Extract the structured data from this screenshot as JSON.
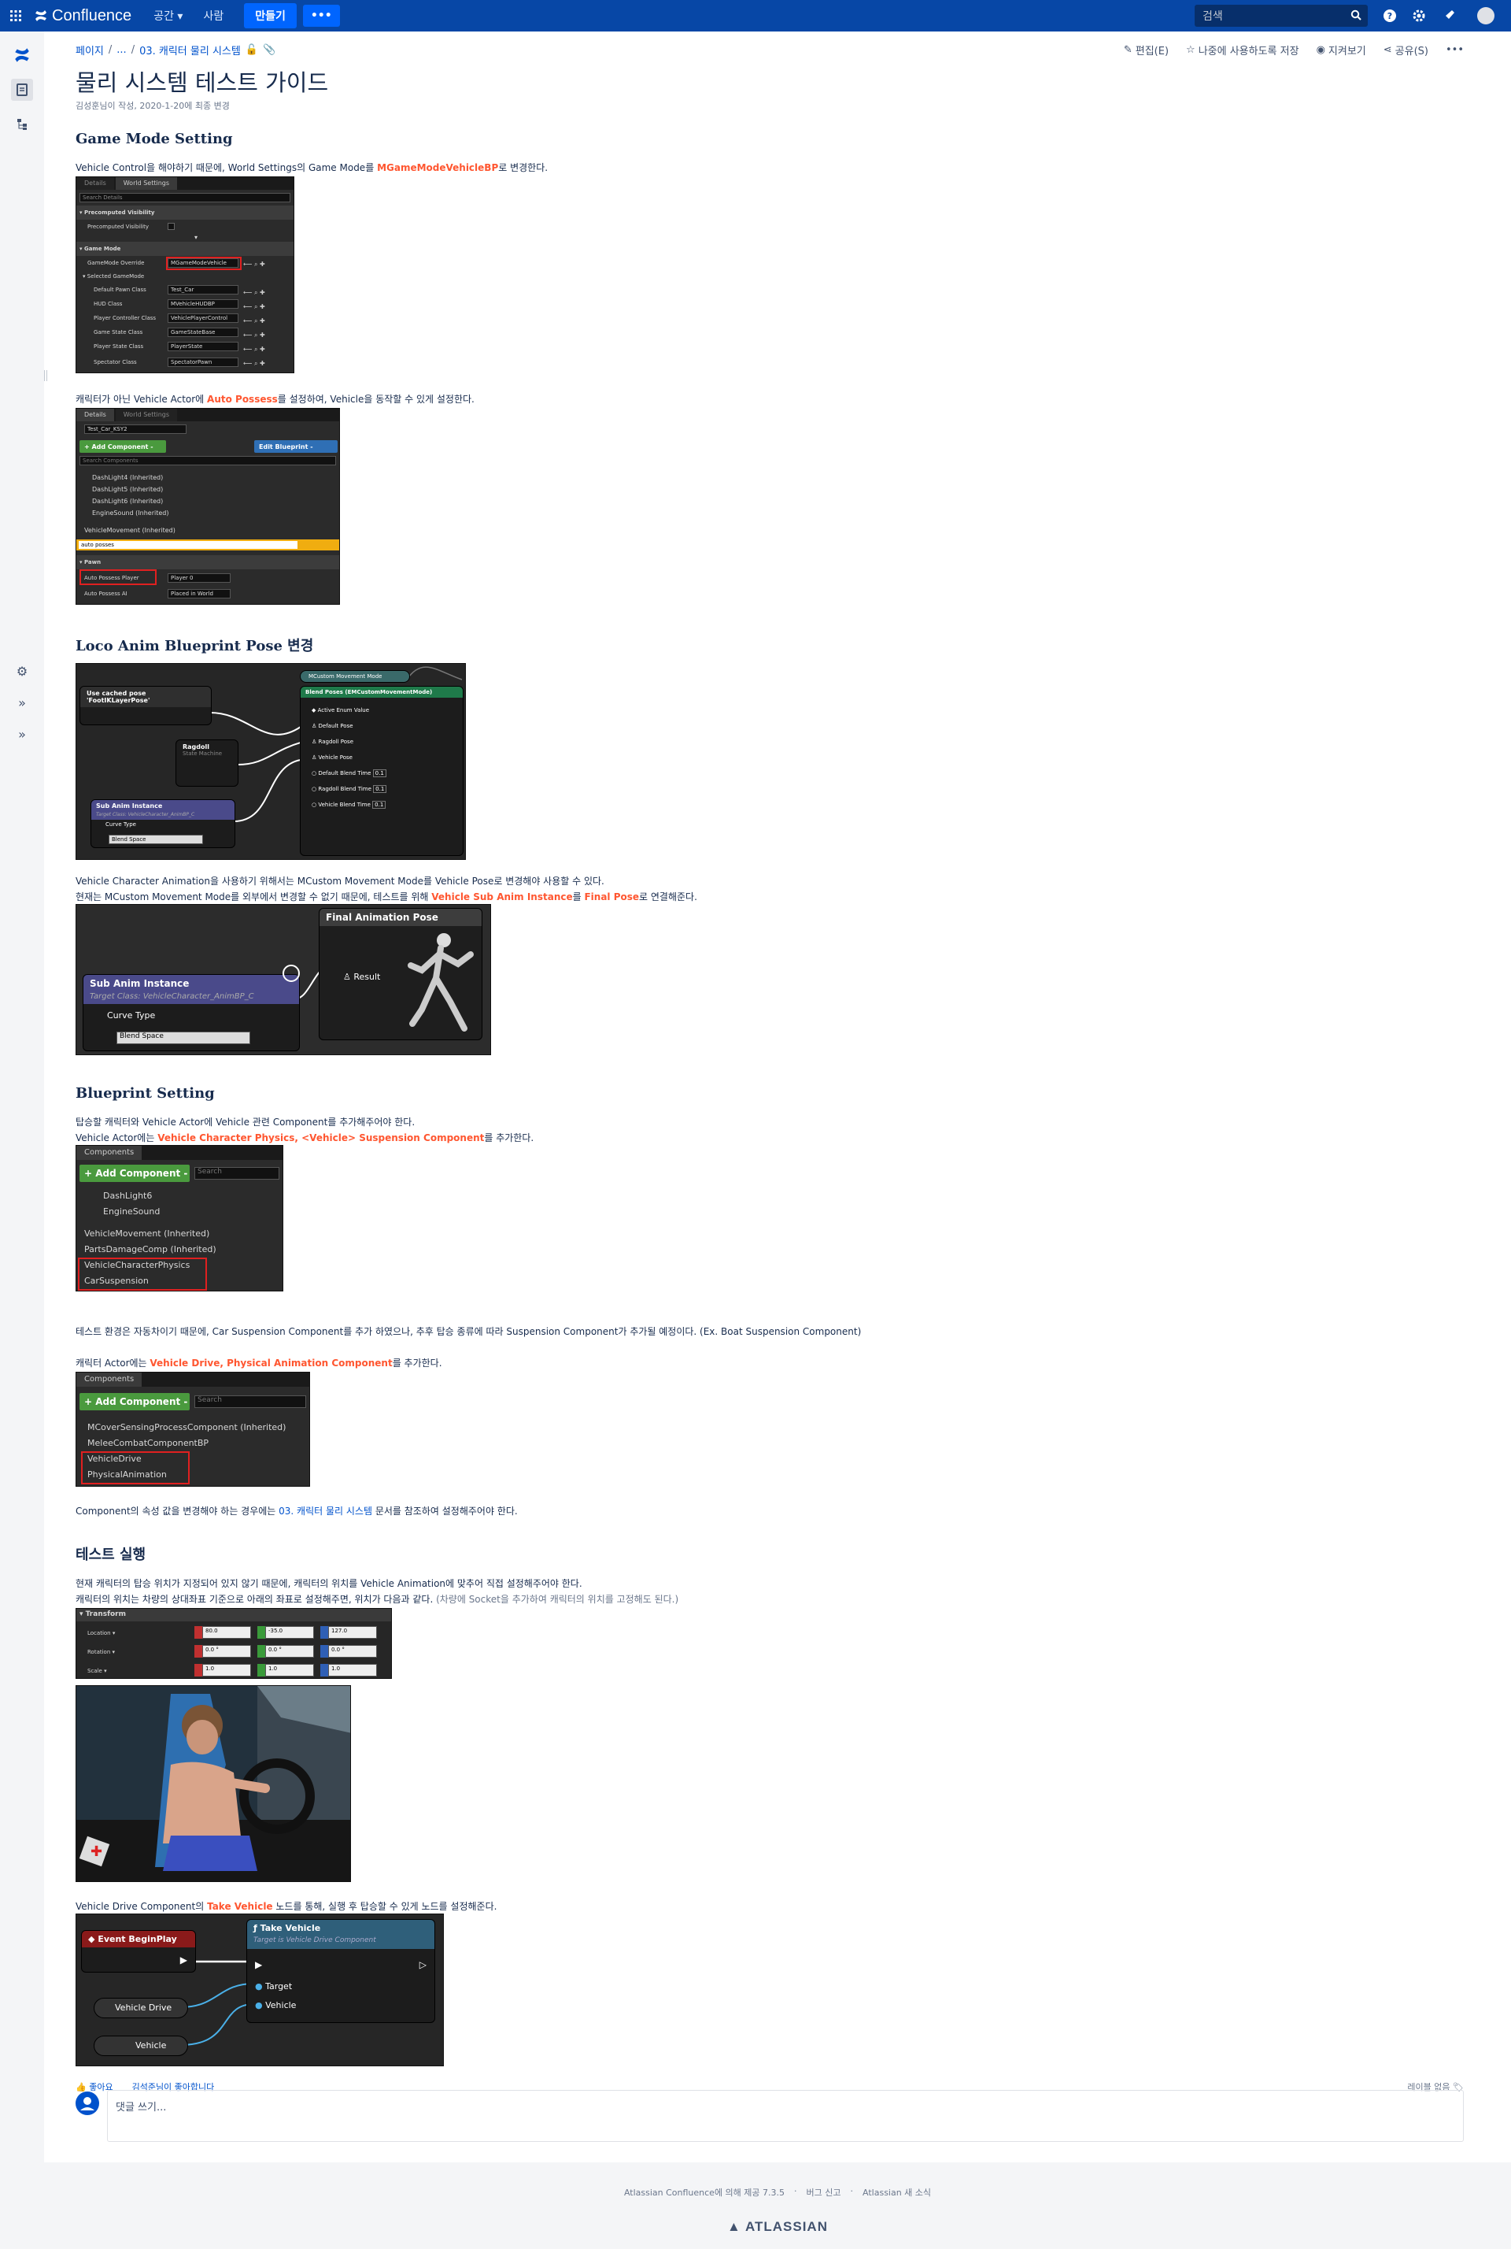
{
  "topbar": {
    "brand": "Confluence",
    "nav": [
      "공간",
      "사람"
    ],
    "create_label": "만들기",
    "more_label": "•••",
    "search_placeholder": "검색"
  },
  "breadcrumb": [
    "페이지",
    "...",
    "03. 캐릭터 물리 시스템"
  ],
  "actions": {
    "edit": "편집(E)",
    "save_for_later": "나중에 사용하도록 저장",
    "watch": "지켜보기",
    "share": "공유(S)",
    "more": "•••"
  },
  "page": {
    "title": "물리 시스템 테스트 가이드",
    "meta": "김성훈님이 작성, 2020-1-20에 최종 변경"
  },
  "sections": {
    "s1_title": "Game Mode Setting",
    "s1_p1_a": "Vehicle Control을 해야하기 때문에, World Settings의 Game Mode를 ",
    "s1_p1_hl": "MGameModeVehicleBP",
    "s1_p1_b": "로 변경한다.",
    "s1_p2_a": "캐릭터가 아닌 Vehicle Actor에 ",
    "s1_p2_hl": "Auto Possess",
    "s1_p2_b": "를 설정하여, Vehicle을 동작할 수 있게 설정한다.",
    "s2_title": "Loco Anim Blueprint Pose 변경",
    "s2_p1": "Vehicle Character Animation을 사용하기 위해서는 MCustom Movement Mode를 Vehicle Pose로 변경해야 사용할 수 있다.",
    "s2_p2_a": "현재는 MCustom Movement Mode를 외부에서 변경할 수 없기 때문에, 테스트를 위해 ",
    "s2_p2_hl1": "Vehicle Sub Anim Instance",
    "s2_p2_mid": "를 ",
    "s2_p2_hl2": "Final Pose",
    "s2_p2_b": "로 연결해준다.",
    "s3_title": "Blueprint Setting",
    "s3_p1": "탑승할 캐릭터와 Vehicle Actor에 Vehicle 관련 Component를 추가해주어야 한다.",
    "s3_p2_a": "Vehicle Actor에는 ",
    "s3_p2_hl": "Vehicle Character Physics, <Vehicle> Suspension Component",
    "s3_p2_b": "를 추가한다.",
    "s3_p3": "테스트 환경은 자동차이기 때문에, Car Suspension Component를 추가 하였으나, 추후 탑승 종류에 따라 Suspension Component가 추가될 예정이다. (Ex. Boat Suspension Component)",
    "s3_p4_a": "캐릭터 Actor에는 ",
    "s3_p4_hl": "Vehicle Drive, Physical Animation Component",
    "s3_p4_b": "를 추가한다.",
    "s3_p5_a": "Component의 속성 값을 변경해야 하는 경우에는 ",
    "s3_p5_link": "03. 캐릭터 물리 시스템",
    "s3_p5_b": " 문서를 참조하여 설정해주어야 한다.",
    "s4_title": "테스트 실행",
    "s4_p1": "현재 캐릭터의 탑승 위치가 지정되어 있지 않기 때문에, 캐릭터의 위치를 Vehicle Animation에 맞추어 직접 설정해주어야 한다.",
    "s4_p2_a": "캐릭터의 위치는 차량의 상대좌표 기준으로 아래의 좌표로 설정해주면, 위치가 다음과 같다. ",
    "s4_p2_muted": "(차량에 Socket을 추가하여 캐릭터의 위치를 고정해도 된다.)",
    "s4_p3_a": "Vehicle Drive Component의 ",
    "s4_p3_hl": "Take Vehicle",
    "s4_p3_b": " 노드를 통해, 실행 후 탑승할 수 있게 노드를 설정해준다."
  },
  "shot1": {
    "tabs": [
      "Details",
      "World Settings"
    ],
    "search": "Search Details",
    "cat1": "Precomputed Visibility",
    "row_pv": "Precomputed Visibility",
    "cat2": "Game Mode",
    "rows": [
      {
        "label": "GameMode Override",
        "value": "MGameModeVehicle"
      },
      {
        "label": "Selected GameMode",
        "value": ""
      },
      {
        "label": "Default Pawn Class",
        "value": "Test_Car"
      },
      {
        "label": "HUD Class",
        "value": "MVehicleHUDBP"
      },
      {
        "label": "Player Controller Class",
        "value": "VehiclePlayerControl"
      },
      {
        "label": "Game State Class",
        "value": "GameStateBase"
      },
      {
        "label": "Player State Class",
        "value": "PlayerState"
      },
      {
        "label": "Spectator Class",
        "value": "SpectatorPawn"
      }
    ]
  },
  "shot2": {
    "tabs": [
      "Details",
      "World Settings"
    ],
    "actor": "Test_Car_KSY2",
    "add_component": "+ Add Component -",
    "edit_blueprint": "Edit Blueprint -",
    "search_components": "Search Components",
    "components": [
      "DashLight4 (Inherited)",
      "DashLight5 (Inherited)",
      "DashLight6 (Inherited)",
      "EngineSound (Inherited)",
      "VehicleMovement (Inherited)"
    ],
    "filter": "auto posses",
    "cat": "Pawn",
    "rows": [
      {
        "label": "Auto Possess Player",
        "value": "Player 0"
      },
      {
        "label": "Auto Possess AI",
        "value": "Placed in World"
      }
    ]
  },
  "shot3": {
    "cached_pose": "Use cached pose 'FootIKLayerPose'",
    "ragdoll": "Ragdoll",
    "ragdoll_sub": "State Machine",
    "sub_anim": "Sub Anim Instance",
    "sub_anim_target": "Target Class: VehicleCharacter_AnimBP_C",
    "curve_type": "Curve Type",
    "blend_space": "Blend Space",
    "mode_var": "MCustom Movement Mode",
    "blend_poses": "Blend Poses (EMCustomMovementMode)",
    "pins": [
      "Active Enum Value",
      "Default Pose",
      "Ragdoll Pose",
      "Vehicle Pose",
      "Default Blend Time",
      "Ragdoll Blend Time",
      "Vehicle Blend Time"
    ],
    "blend_val": "0.1"
  },
  "shot4": {
    "sub_anim": "Sub Anim Instance",
    "target": "Target Class: VehicleCharacter_AnimBP_C",
    "curve_type": "Curve Type",
    "blend_space": "Blend Space",
    "final_pose": "Final Animation Pose",
    "result": "Result"
  },
  "shot5": {
    "tab": "Components",
    "add_component": "+ Add Component -",
    "search": "Search",
    "items": [
      "DashLight6",
      "EngineSound",
      "VehicleMovement (Inherited)",
      "PartsDamageComp (Inherited)",
      "VehicleCharacterPhysics",
      "CarSuspension"
    ]
  },
  "shot6": {
    "tab": "Components",
    "add_component": "+ Add Component -",
    "search": "Search",
    "items": [
      "MCoverSensingProcessComponent (Inherited)",
      "MeleeCombatComponentBP",
      "VehicleDrive",
      "PhysicalAnimation"
    ]
  },
  "shot7": {
    "header": "Transform",
    "rows": [
      {
        "label": "Location",
        "x": "80.0",
        "y": "-35.0",
        "z": "127.0"
      },
      {
        "label": "Rotation",
        "x": "0.0 °",
        "y": "0.0 °",
        "z": "0.0 °"
      },
      {
        "label": "Scale",
        "x": "1.0",
        "y": "1.0",
        "z": "1.0"
      }
    ]
  },
  "shot9": {
    "event": "Event BeginPlay",
    "take_vehicle": "Take Vehicle",
    "take_target": "Target is Vehicle Drive Component",
    "pin_target": "Target",
    "pin_vehicle": "Vehicle",
    "var_drive": "Vehicle Drive",
    "var_vehicle": "Vehicle"
  },
  "bottom": {
    "like": "좋아요",
    "liked_by": "김석준님이 좋아합니다",
    "no_labels": "레이블 없음",
    "comment_placeholder": "댓글 쓰기..."
  },
  "footer": {
    "powered": "Atlassian Confluence에 의해 제공 7.3.5",
    "report": "버그 신고",
    "news": "Atlassian 새 소식",
    "logo": "ATLASSIAN"
  },
  "colors": {
    "topbar": "#0747a6",
    "link": "#0052cc",
    "highlight": "#ff5630"
  }
}
